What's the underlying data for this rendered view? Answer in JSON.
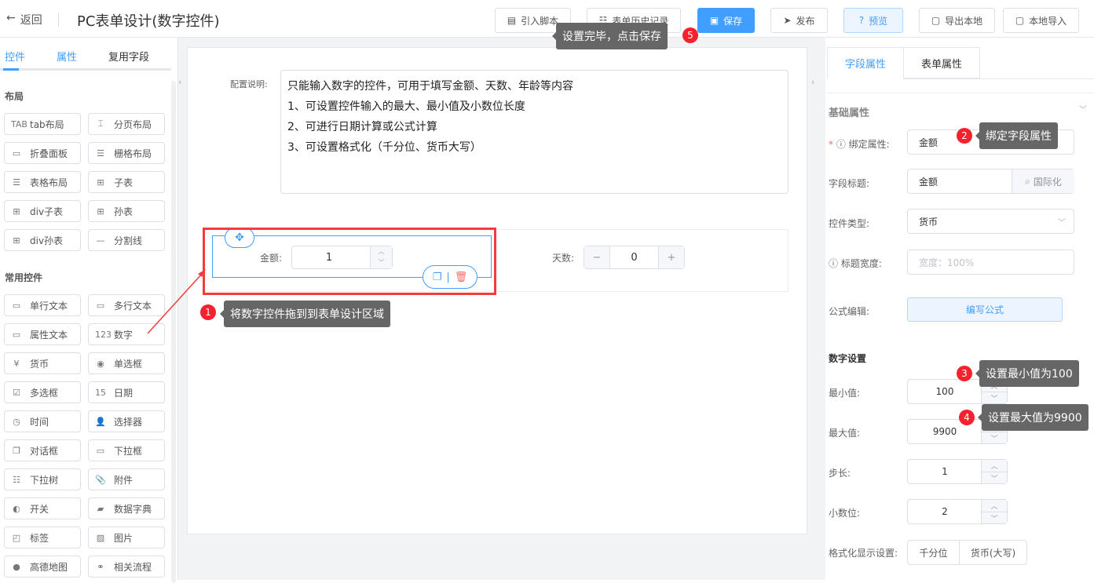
{
  "header": {
    "back": "返回",
    "title": "PC表单设计(数字控件)",
    "buttons": [
      {
        "label": "引入脚本",
        "icon": "script-icon"
      },
      {
        "label": "表单历史记录",
        "icon": "history-icon"
      },
      {
        "label": "保存",
        "icon": "save-icon"
      },
      {
        "label": "发布",
        "icon": "send-icon"
      },
      {
        "label": "预览",
        "icon": "preview-icon"
      },
      {
        "label": "导出本地",
        "icon": "folder-icon"
      },
      {
        "label": "本地导入",
        "icon": "folder-open-icon"
      }
    ]
  },
  "left": {
    "tabs": [
      "控件",
      "属性",
      "复用字段"
    ],
    "layout_title": "布局",
    "layout_items": [
      {
        "label": "tab布局",
        "icon": "TAB"
      },
      {
        "label": "分页布局",
        "icon": "⌶"
      },
      {
        "label": "折叠面板",
        "icon": "▭"
      },
      {
        "label": "栅格布局",
        "icon": "☰"
      },
      {
        "label": "表格布局",
        "icon": "☰"
      },
      {
        "label": "子表",
        "icon": "⊞"
      },
      {
        "label": "div子表",
        "icon": "⊞"
      },
      {
        "label": "孙表",
        "icon": "⊞"
      },
      {
        "label": "div孙表",
        "icon": "⊞"
      },
      {
        "label": "分割线",
        "icon": "—"
      }
    ],
    "common_title": "常用控件",
    "common_items": [
      {
        "label": "单行文本",
        "icon": "▭"
      },
      {
        "label": "多行文本",
        "icon": "▭"
      },
      {
        "label": "属性文本",
        "icon": "▭"
      },
      {
        "label": "数字",
        "icon": "123"
      },
      {
        "label": "货币",
        "icon": "¥"
      },
      {
        "label": "单选框",
        "icon": "◉"
      },
      {
        "label": "多选框",
        "icon": "☑"
      },
      {
        "label": "日期",
        "icon": "15"
      },
      {
        "label": "时间",
        "icon": "◷"
      },
      {
        "label": "选择器",
        "icon": "👤"
      },
      {
        "label": "对话框",
        "icon": "❐"
      },
      {
        "label": "下拉框",
        "icon": "▭"
      },
      {
        "label": "下拉树",
        "icon": "☷"
      },
      {
        "label": "附件",
        "icon": "📎"
      },
      {
        "label": "开关",
        "icon": "◐"
      },
      {
        "label": "数据字典",
        "icon": "▰"
      },
      {
        "label": "标签",
        "icon": "◰"
      },
      {
        "label": "图片",
        "icon": "▨"
      },
      {
        "label": "高德地图",
        "icon": "●"
      },
      {
        "label": "相关流程",
        "icon": "⚭"
      }
    ]
  },
  "canvas": {
    "desc_label": "配置说明:",
    "desc_lines": [
      "只能输入数字的控件，可用于填写金额、天数、年龄等内容",
      "1、可设置控件输入的最大、最小值及小数位长度",
      "2、可进行日期计算或公式计算",
      "3、可设置格式化（千分位、货币大写）"
    ],
    "amount_label": "金额:",
    "amount_value": "1",
    "days_label": "天数:",
    "days_value": "0"
  },
  "right": {
    "tabs": [
      "字段属性",
      "表单属性"
    ],
    "basic_title": "基础属性",
    "bind_label": "绑定属性:",
    "bind_value": "金额",
    "title_label": "字段标题:",
    "title_value": "金额",
    "i18n": "国际化",
    "type_label": "控件类型:",
    "type_value": "货币",
    "width_label": "标题宽度:",
    "width_placeholder": "宽度：100%",
    "formula_label": "公式编辑:",
    "formula_button": "编写公式",
    "num_title": "数字设置",
    "min_label": "最小值:",
    "min_value": "100",
    "max_label": "最大值:",
    "max_value": "9900",
    "step_label": "步长:",
    "step_value": "1",
    "decimal_label": "小数位:",
    "decimal_value": "2",
    "format_label": "格式化显示设置:",
    "format_options": [
      "千分位",
      "货币(大写)"
    ]
  },
  "annotations": [
    {
      "n": "1",
      "text": "将数字控件拖到到表单设计区域"
    },
    {
      "n": "2",
      "text": "绑定字段属性"
    },
    {
      "n": "3",
      "text": "设置最小值为100"
    },
    {
      "n": "4",
      "text": "设置最大值为9900"
    },
    {
      "n": "5",
      "text": "设置完毕，点击保存"
    }
  ],
  "colors": {
    "accent": "#409eff",
    "annotation": "#f5222d",
    "tooltip": "#666666"
  }
}
